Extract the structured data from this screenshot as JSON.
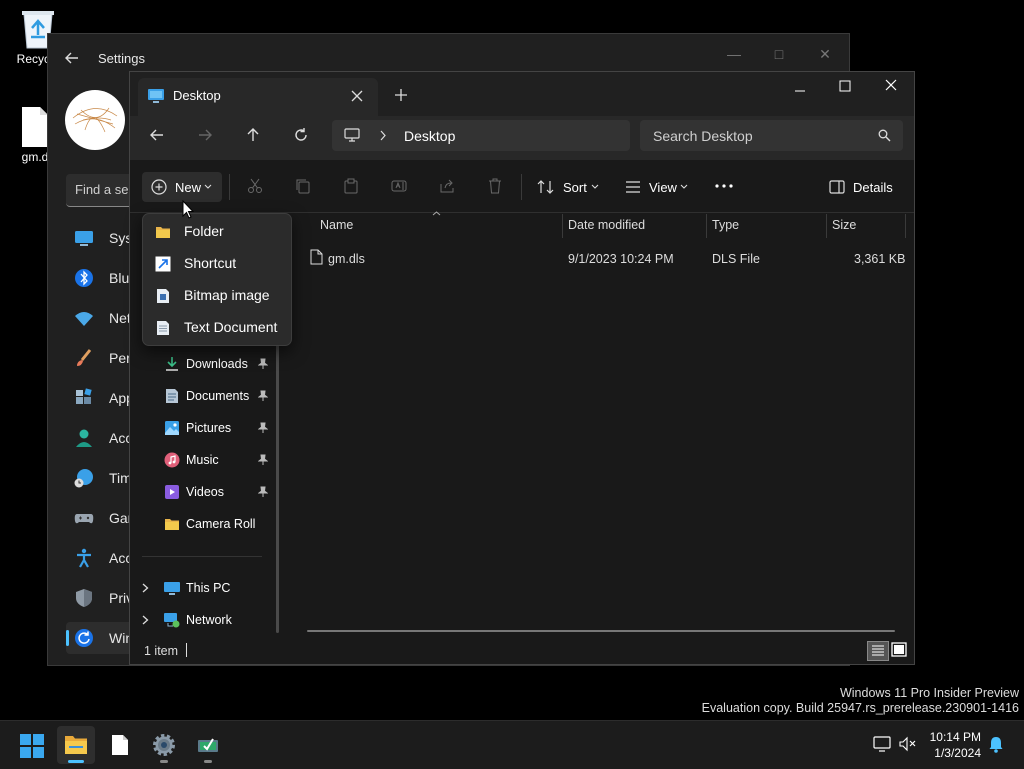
{
  "desktop": {
    "icons": [
      {
        "label": "Recycle",
        "icon": "recycle-bin-icon"
      },
      {
        "label": "gm.d",
        "icon": "file-icon"
      }
    ]
  },
  "settings": {
    "title": "Settings",
    "search_placeholder": "Find a se",
    "nav": [
      {
        "label": "Syst",
        "icon": "system-icon"
      },
      {
        "label": "Blue",
        "icon": "bluetooth-icon"
      },
      {
        "label": "Net",
        "icon": "wifi-icon"
      },
      {
        "label": "Pers",
        "icon": "brush-icon"
      },
      {
        "label": "App",
        "icon": "apps-icon"
      },
      {
        "label": "Acc",
        "icon": "accounts-icon"
      },
      {
        "label": "Tim",
        "icon": "time-icon"
      },
      {
        "label": "Gar",
        "icon": "gaming-icon"
      },
      {
        "label": "Acc",
        "icon": "accessibility-icon"
      },
      {
        "label": "Priv",
        "icon": "shield-icon"
      },
      {
        "label": "Win",
        "icon": "windows-update-icon",
        "selected": true
      }
    ]
  },
  "explorer": {
    "tab_title": "Desktop",
    "address": "Desktop",
    "search_placeholder": "Search Desktop",
    "toolbar": {
      "new_label": "New",
      "sort_label": "Sort",
      "view_label": "View",
      "details_label": "Details"
    },
    "columns": [
      "Name",
      "Date modified",
      "Type",
      "Size"
    ],
    "files": [
      {
        "name": "gm.dls",
        "date": "9/1/2023 10:24 PM",
        "type": "DLS File",
        "size": "3,361 KB"
      }
    ],
    "quick_access": [
      {
        "label": "Downloads",
        "icon": "download-icon",
        "pinned": true
      },
      {
        "label": "Documents",
        "icon": "documents-icon",
        "pinned": true
      },
      {
        "label": "Pictures",
        "icon": "pictures-icon",
        "pinned": true
      },
      {
        "label": "Music",
        "icon": "music-icon",
        "pinned": true
      },
      {
        "label": "Videos",
        "icon": "videos-icon",
        "pinned": true
      },
      {
        "label": "Camera Roll",
        "icon": "folder-icon",
        "pinned": false
      }
    ],
    "tree": [
      {
        "label": "This PC",
        "icon": "this-pc-icon"
      },
      {
        "label": "Network",
        "icon": "network-icon"
      }
    ],
    "status": "1 item"
  },
  "new_menu": {
    "items": [
      {
        "label": "Folder",
        "icon": "folder-icon"
      },
      {
        "label": "Shortcut",
        "icon": "shortcut-icon"
      },
      {
        "label": "Bitmap image",
        "icon": "bitmap-icon"
      },
      {
        "label": "Text Document",
        "icon": "text-document-icon"
      }
    ]
  },
  "watermark": {
    "line1": "Windows 11 Pro Insider Preview",
    "line2": "Evaluation copy. Build 25947.rs_prerelease.230901-1416"
  },
  "taskbar": {
    "time": "10:14 PM",
    "date": "1/3/2024"
  },
  "colors": {
    "accent": "#4cc2ff",
    "folder": "#f2c94c",
    "window_bg": "#191919"
  }
}
